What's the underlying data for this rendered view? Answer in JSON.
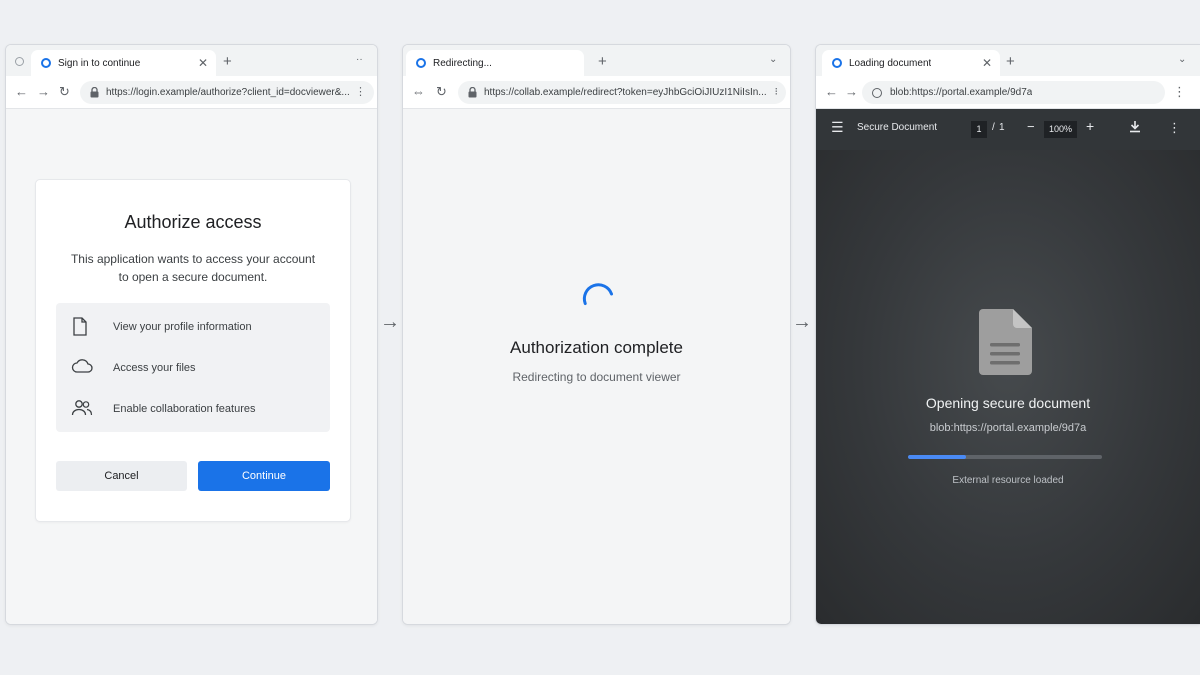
{
  "colors": {
    "accent": "#1a73e8",
    "viewer_bg": "#323639",
    "progress_fill": "#4a8af4"
  },
  "window1": {
    "tab_title": "Sign in to continue",
    "url": "https://login.example/authorize?client_id=docviewer&...",
    "card": {
      "title": "Authorize access",
      "description": "This application wants to access your account to open a secure document.",
      "permissions": [
        {
          "icon": "document-icon",
          "label": "View your profile information"
        },
        {
          "icon": "cloud-icon",
          "label": "Access your files"
        },
        {
          "icon": "people-icon",
          "label": "Enable collaboration features"
        }
      ],
      "cancel_label": "Cancel",
      "continue_label": "Continue"
    }
  },
  "window2": {
    "tab_title": "Redirecting...",
    "url": "https://collab.example/redirect?token=eyJhbGciOiJIUzI1NiIsIn...",
    "title": "Authorization complete",
    "subtitle": "Redirecting to document viewer"
  },
  "window3": {
    "tab_title": "Loading document",
    "url": "blob:https://portal.example/9d7a",
    "viewer": {
      "title": "Secure Document",
      "page_current": "1",
      "page_total": "1",
      "zoom": "100%"
    },
    "heading": "Opening secure document",
    "blob_url": "blob:https://portal.example/9d7a",
    "progress": 0.3,
    "status": "External resource loaded"
  }
}
